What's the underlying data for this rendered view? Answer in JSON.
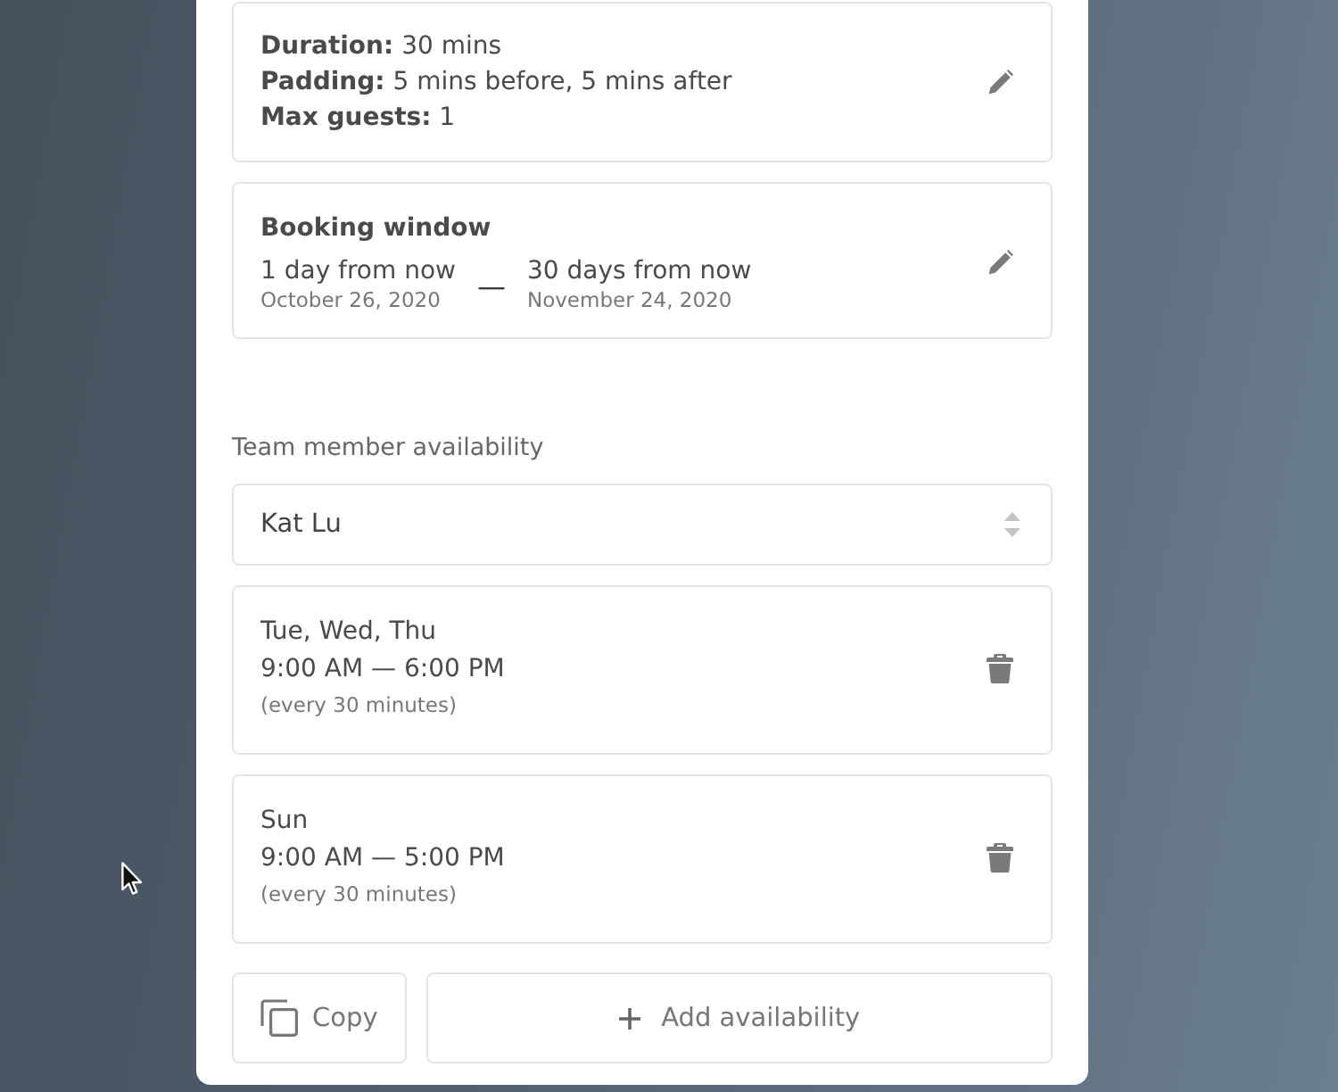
{
  "details": {
    "lines": [
      "**Duration:** 30 mins",
      "**Padding:** 5 mins before, 5 mins after",
      "**Max guests:** 1"
    ]
  },
  "booking_window": {
    "title": "Booking window",
    "start": {
      "relative": "1 day from now",
      "date": "October 26, 2020"
    },
    "separator": "—",
    "end": {
      "relative": "30 days from now",
      "date": "November 24, 2020"
    }
  },
  "team_availability": {
    "label": "Team member availability",
    "member_select": {
      "value": "Kat Lu"
    },
    "slots": [
      {
        "days": "Tue, Wed, Thu",
        "hours": "9:00 AM — 6:00 PM",
        "interval": "(every 30 minutes)"
      },
      {
        "days": "Sun",
        "hours": "9:00 AM — 5:00 PM",
        "interval": "(every 30 minutes)"
      }
    ]
  },
  "actions": {
    "copy": "Copy",
    "add": "Add availability"
  }
}
